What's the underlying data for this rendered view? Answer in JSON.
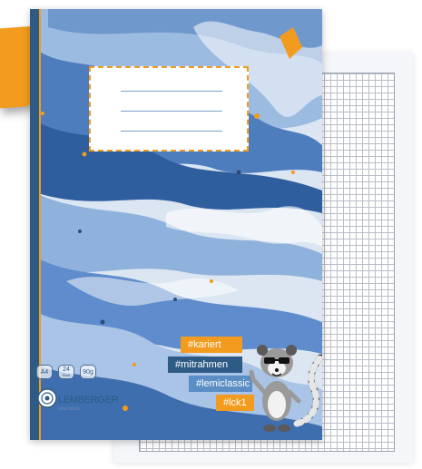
{
  "cover": {
    "tags": [
      "#kariert",
      "#mitrahmen",
      "#lemiclassic",
      "#lck1"
    ],
    "specs": {
      "format": "A4",
      "sheets_value": "24",
      "sheets_unit": "Blatt",
      "weight": "90g"
    },
    "brand": {
      "name": "LEMBERGER",
      "tagline": "educations"
    }
  },
  "colors": {
    "accent_orange": "#f29b1e",
    "navy": "#2e5b86",
    "grid_line": "#b9bec7"
  }
}
